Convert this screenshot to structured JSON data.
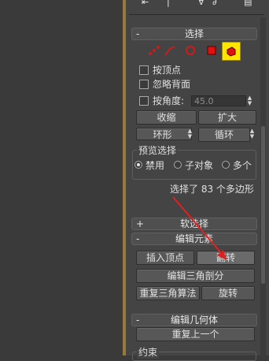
{
  "colors": {
    "viewport_bg": "#3a3a3a",
    "panel_bg": "#444444",
    "accent_border": "#9a7a3a",
    "selected_icon_bg": "#ffe500",
    "vertex_red": "#d11a1a",
    "arrow_red": "#e02020"
  },
  "selection_rollout": {
    "sign": "-",
    "title": "选择",
    "subobject_icons": [
      "vertex-icon",
      "edge-icon",
      "border-icon",
      "polygon-icon",
      "element-icon"
    ],
    "by_vertex": "按顶点",
    "ignore_backfacing": "忽略背面",
    "by_angle": "按角度:",
    "angle_value": "45.0",
    "shrink": "收缩",
    "grow": "扩大",
    "ring": "环形",
    "loop": "循环",
    "preview_selection": {
      "title": "预览选择",
      "options": [
        "禁用",
        "子对象",
        "多个"
      ],
      "selected": "禁用"
    },
    "status": "选择了 83 个多边形"
  },
  "soft_selection": {
    "sign": "+",
    "title": "软选择"
  },
  "edit_elements": {
    "sign": "-",
    "title": "编辑元素",
    "insert_vertex": "插入顶点",
    "flip": "翻转",
    "edit_triangulation": "编辑三角剖分",
    "retriangulate": "重复三角算法",
    "turn": "旋转"
  },
  "edit_geometry": {
    "sign": "-",
    "title": "编辑几何体",
    "repeat_last": "重复上一个",
    "constraints": "约束"
  }
}
